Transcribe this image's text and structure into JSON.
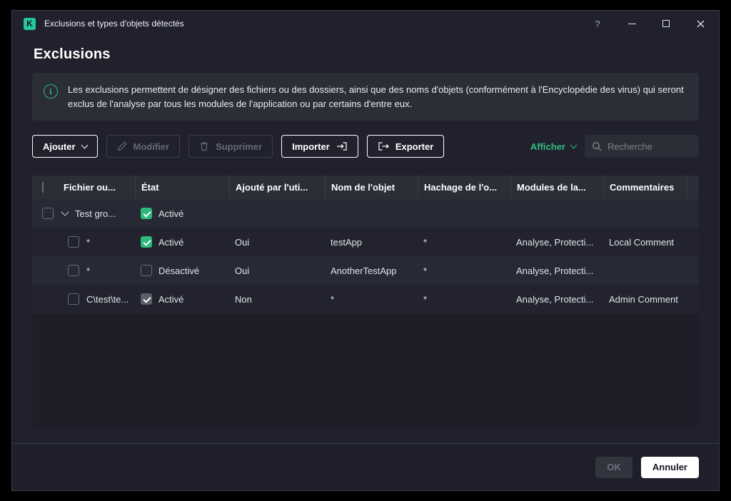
{
  "window": {
    "title": "Exclusions et types d'objets détectés",
    "help": "?"
  },
  "page": {
    "title": "Exclusions",
    "info_icon": "i",
    "info_text": "Les exclusions permettent de désigner des fichiers ou des dossiers, ainsi que des noms d'objets (conformément à l'Encyclopédie des virus) qui seront exclus de l'analyse par tous les modules de l'application ou par certains d'entre eux."
  },
  "toolbar": {
    "add_label": "Ajouter",
    "modify_label": "Modifier",
    "delete_label": "Supprimer",
    "import_label": "Importer",
    "export_label": "Exporter",
    "show_label": "Afficher",
    "search_placeholder": "Recherche"
  },
  "table": {
    "columns": [
      "Fichier ou...",
      "État",
      "Ajouté par l'uti...",
      "Nom de l'objet",
      "Hachage de l'o...",
      "Modules de la...",
      "Commentaires"
    ],
    "group": {
      "name": "Test gro...",
      "state_label": "Activé",
      "state_checked": true
    },
    "rows": [
      {
        "file": "*",
        "state_label": "Activé",
        "state_checked": true,
        "state_disabled": false,
        "added": "Oui",
        "name": "testApp",
        "hash": "*",
        "modules": "Analyse, Protecti...",
        "comment": "Local Comment"
      },
      {
        "file": "*",
        "state_label": "Désactivé",
        "state_checked": false,
        "state_disabled": false,
        "added": "Oui",
        "name": "AnotherTestApp",
        "hash": "*",
        "modules": "Analyse, Protecti...",
        "comment": ""
      },
      {
        "file": "C\\test\\te...",
        "state_label": "Activé",
        "state_checked": true,
        "state_disabled": true,
        "added": "Non",
        "name": "*",
        "hash": "*",
        "modules": "Analyse, Protecti...",
        "comment": "Admin Comment"
      }
    ]
  },
  "footer": {
    "ok_label": "OK",
    "cancel_label": "Annuler"
  },
  "colors": {
    "accent_green": "#2db97c",
    "brand_green": "#23c99a"
  }
}
